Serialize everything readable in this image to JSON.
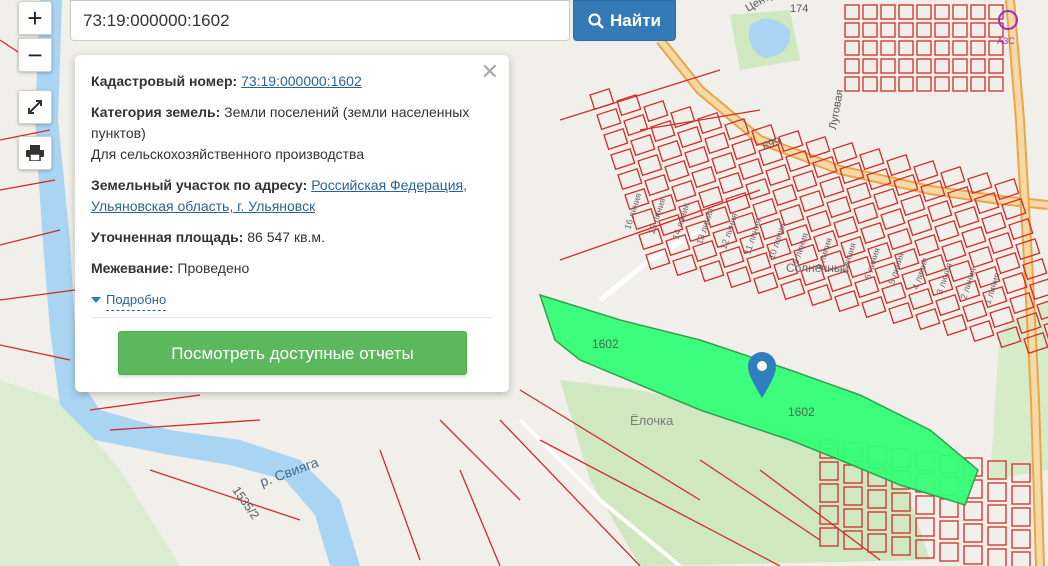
{
  "search": {
    "value": "73:19:000000:1602",
    "button_label": "Найти"
  },
  "controls": {
    "zoom_in": "+",
    "zoom_out": "−"
  },
  "popup": {
    "cadastral_label": "Кадастровый номер:",
    "cadastral_value": "73:19:000000:1602",
    "category_label": "Категория земель:",
    "category_value": "Земли поселений (земли населенных пунктов)",
    "category_use": "Для сельскохозяйственного производства",
    "address_label": "Земельный участок по адресу:",
    "address_value": "Российская Федерация, Ульяновская область, г. Ульяновск",
    "area_label": "Уточненная площадь:",
    "area_value": "86 547 кв.м.",
    "survey_label": "Межевание:",
    "survey_value": "Проведено",
    "details_link": "Подробно",
    "reports_button": "Посмотреть доступные отчеты",
    "close_symbol": "✕"
  },
  "map": {
    "parcel_labels": [
      "1602",
      "1602"
    ],
    "place_labels": [
      "Ёлочка",
      "р. Свияга",
      "1535/2",
      "899",
      "Солнечный"
    ],
    "street_labels": [
      "16 линия",
      "15 линия",
      "14 линия",
      "13 линия",
      "12 линия",
      "11 линия",
      "10 линия",
      "9 линия",
      "8 линия",
      "7 линия",
      "6 линия",
      "5 линия",
      "4 линия",
      "3 линия",
      "2 линия",
      "1 линия",
      "Центральная",
      "Луговая"
    ],
    "road_number": "174",
    "badge": "АЗС",
    "colors": {
      "parcel_fill": "#33ff77",
      "parcel_outline": "#d12b2b",
      "water": "#a9d4f2",
      "green": "#cfe8bf",
      "road": "#f2c987",
      "background": "#f1efe9",
      "marker": "#2f7ec0"
    }
  },
  "icons": [
    "search-icon",
    "fullscreen-icon",
    "print-icon",
    "close-icon",
    "map-marker-icon",
    "caret-down-icon"
  ]
}
